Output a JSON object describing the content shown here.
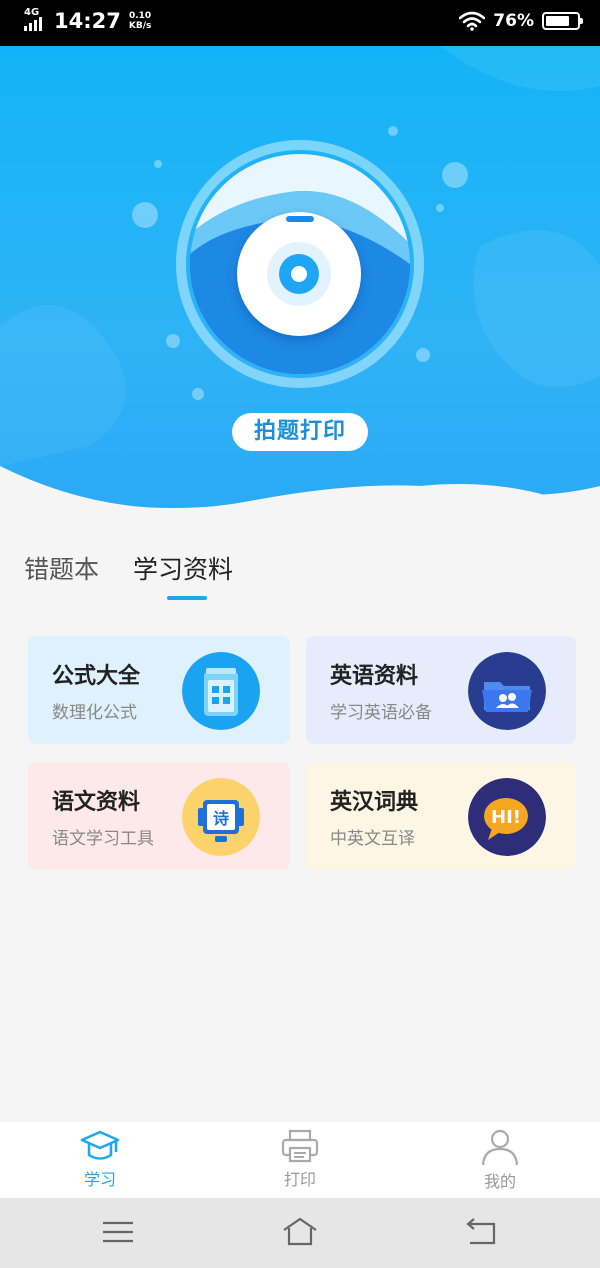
{
  "status_bar": {
    "network": "4G",
    "time": "14:27",
    "speed_value": "0.10",
    "speed_unit": "KB/s",
    "battery": "76%",
    "battery_level": 0.76
  },
  "hero": {
    "action_label": "拍题打印"
  },
  "tabs": [
    {
      "label": "错题本",
      "active": false
    },
    {
      "label": "学习资料",
      "active": true
    }
  ],
  "cards": [
    {
      "title": "公式大全",
      "subtitle": "数理化公式",
      "icon": "calculator-icon"
    },
    {
      "title": "英语资料",
      "subtitle": "学习英语必备",
      "icon": "folder-users-icon"
    },
    {
      "title": "语文资料",
      "subtitle": "语文学习工具",
      "icon": "poem-book-icon",
      "icon_text": "诗"
    },
    {
      "title": "英汉词典",
      "subtitle": "中英文互译",
      "icon": "hi-speech-bubble-icon",
      "icon_text": "HI!"
    }
  ],
  "bottom_nav": [
    {
      "label": "学习",
      "icon": "graduation-cap-icon",
      "active": true
    },
    {
      "label": "打印",
      "icon": "printer-icon",
      "active": false
    },
    {
      "label": "我的",
      "icon": "user-icon",
      "active": false
    }
  ],
  "colors": {
    "accent": "#1da6f1",
    "hero_top": "#12b4f7",
    "hero_bottom": "#2aa8f5"
  }
}
